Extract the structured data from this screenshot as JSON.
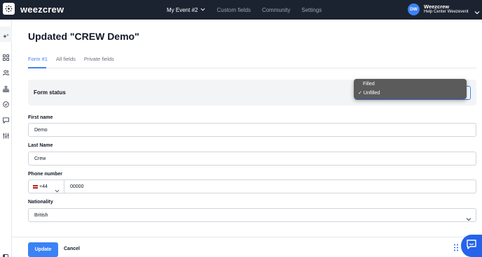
{
  "app": {
    "logo_text": "weezcrew",
    "icons": {
      "logo": "weezcrew-logo-icon",
      "user_menu": "chevron-down-icon"
    }
  },
  "nav": {
    "event_label": "My Event #2",
    "items": [
      "Custom fields",
      "Community",
      "Settings"
    ]
  },
  "user": {
    "initials": "DW",
    "name": "Weezcrew",
    "subtitle": "Help Center Weezevent"
  },
  "sidebar": {
    "icons": [
      "sparkle-icon",
      "grid-icon",
      "users-icon",
      "org-chart-icon",
      "check-circle-icon",
      "chat-icon",
      "sliders-icon"
    ],
    "collapse_icon": "panel-toggle-icon"
  },
  "page": {
    "title": "Updated \"CREW Demo\""
  },
  "tabs": [
    "Form #1",
    "All fields",
    "Private fields"
  ],
  "form_status": {
    "label": "Form status",
    "options": [
      "Filled",
      "✓ Unfilled"
    ],
    "selected": "Unfilled"
  },
  "fields": {
    "first_name": {
      "label": "First name",
      "value": "Demo"
    },
    "last_name": {
      "label": "Last Name",
      "value": "Crew"
    },
    "phone": {
      "label": "Phone number",
      "prefix": "+44",
      "value": "00000"
    },
    "nationality": {
      "label": "Nationality",
      "value": "British"
    }
  },
  "actions": {
    "update": "Update",
    "cancel": "Cancel"
  },
  "colors": {
    "topbar": "#1c2330",
    "accent": "#3b82f6",
    "dropdown_bg": "#5b5b5b"
  }
}
